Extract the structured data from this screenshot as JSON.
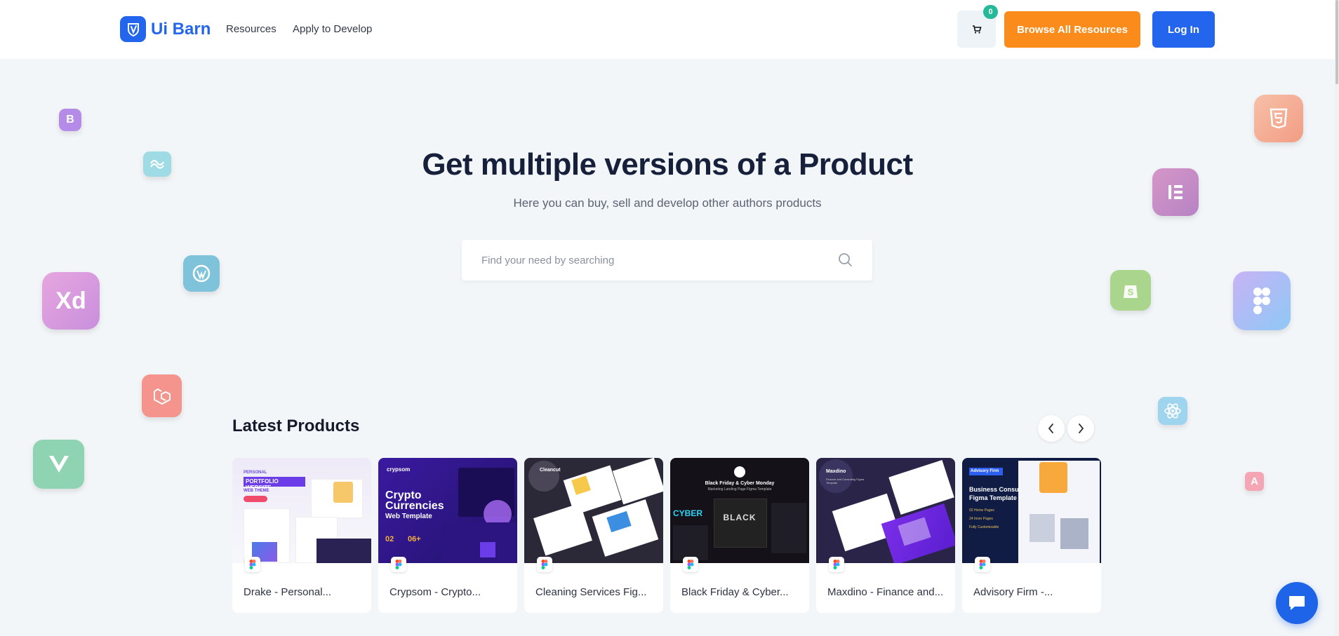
{
  "brand": {
    "name": "Ui Barn",
    "color": "#2465ee"
  },
  "nav": {
    "links": [
      "Resources",
      "Apply to Develop"
    ],
    "cart_count": "0",
    "browse_label": "Browse All Resources",
    "login_label": "Log In"
  },
  "hero": {
    "title": "Get multiple versions of a Product",
    "subtitle": "Here you can buy, sell and develop other authors products",
    "search_placeholder": "Find your need by searching"
  },
  "tech_icons": {
    "bootstrap": "B",
    "tailwind": "tailwind-icon",
    "wordpress": "wordpress-icon",
    "xd": "Xd",
    "laravel": "laravel-icon",
    "vue": "vue-icon",
    "html5": "html5-icon",
    "elementor": "elementor-icon",
    "shopify": "shopify-icon",
    "figma": "figma-icon",
    "react": "react-icon",
    "angular": "A"
  },
  "latest": {
    "title": "Latest Products",
    "products": [
      {
        "title": "Drake - Personal..."
      },
      {
        "title": "Crypsom - Crypto..."
      },
      {
        "title": "Cleaning Services Fig..."
      },
      {
        "title": "Black Friday & Cyber..."
      },
      {
        "title": "Maxdino - Finance and..."
      },
      {
        "title": "Advisory Firm -..."
      }
    ]
  },
  "thumb_text": {
    "drake": {
      "tag": "PERSONAL",
      "heading": "PORTFOLIO WEBSITE",
      "sub": "WEB THEME"
    },
    "crypsom": {
      "brand": "crypsom",
      "line1": "Crypto",
      "line2": "Currencies",
      "line3": "Web Template",
      "stat1": "02",
      "stat2": "06+"
    },
    "cleaning": {
      "brand": "Cleancut"
    },
    "blackfriday": {
      "line1": "Black Friday & Cyber Monday",
      "line2": "Marketing Landing Page Figma Template",
      "big": "BLACK",
      "left": "CYBER"
    },
    "maxdino": {
      "brand": "Maxdino",
      "sub": "Finance and Consulting Figma Template"
    },
    "advisory": {
      "brand": "Advisory Firm",
      "line1": "Business Consulting",
      "line2": "Figma Template",
      "b1": "02 Home Pages",
      "b2": "24 Inner Pages",
      "b3": "Fully Customizable"
    }
  },
  "colors": {
    "orange": "#fb8c1b",
    "blue": "#2465ee",
    "green_badge": "#25b99a",
    "background": "#f3f6f8"
  }
}
